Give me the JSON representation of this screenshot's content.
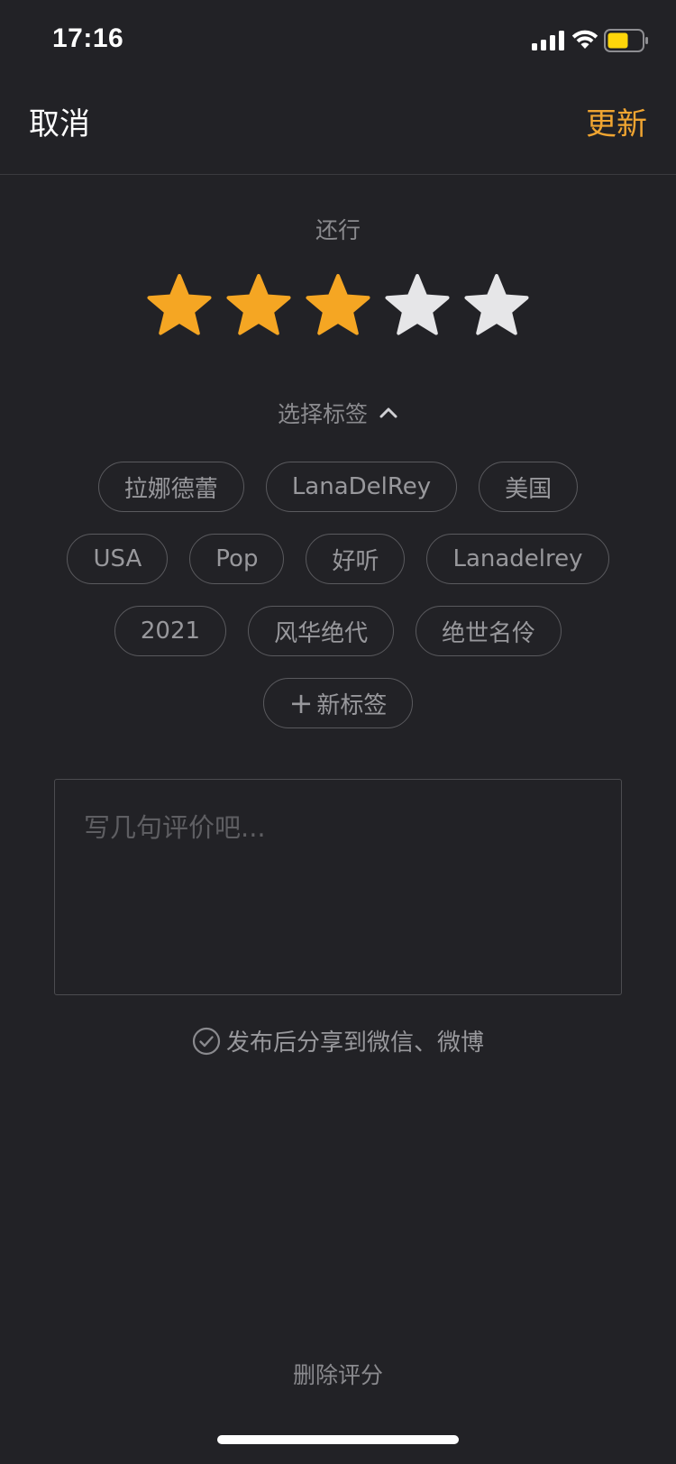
{
  "status_bar": {
    "time": "17:16",
    "icons": [
      "signal-icon",
      "wifi-icon",
      "battery-icon"
    ],
    "battery_color": "#ffd60a"
  },
  "nav": {
    "cancel_label": "取消",
    "update_label": "更新"
  },
  "rating": {
    "label": "还行",
    "value": 3,
    "max": 5,
    "filled_color": "#f5a623",
    "empty_color": "#e6e6e8"
  },
  "tags": {
    "header_label": "选择标签",
    "header_icon": "chevron-up-icon",
    "rows": [
      [
        "拉娜德蕾",
        "LanaDelRey",
        "美国"
      ],
      [
        "USA",
        "Pop",
        "好听",
        "Lanadelrey"
      ],
      [
        "2021",
        "风华绝代",
        "绝世名伶"
      ]
    ],
    "new_tag_label": "新标签",
    "new_tag_icon": "plus-icon"
  },
  "comment": {
    "placeholder": "写几句评价吧...",
    "value": ""
  },
  "share": {
    "label": "发布后分享到微信、微博",
    "icon": "check-circle-icon"
  },
  "delete_label": "删除评分",
  "colors": {
    "background": "#222226",
    "accent": "#f0a531",
    "muted_text": "#8a8a8e"
  }
}
